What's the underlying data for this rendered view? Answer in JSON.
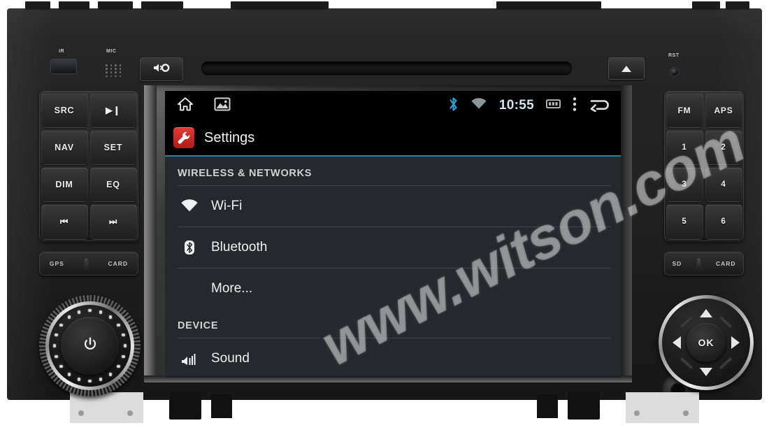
{
  "product": {
    "type": "car-head-unit",
    "watermark": "www.witson.com"
  },
  "front_panel": {
    "ir_label": "IR",
    "mic_label": "MIC",
    "rst_label": "RST",
    "mute_button": {
      "name": "mute-button",
      "icon": "speaker-mute-icon"
    },
    "disc_slot": {
      "name": "cd-disc-slot"
    },
    "eject_button": {
      "name": "eject-button",
      "icon": "eject-triangle-icon"
    },
    "left_keys": [
      "SRC",
      "▶❙",
      "NAV",
      "SET",
      "DIM",
      "EQ",
      "⏮",
      "⏭"
    ],
    "left_slots": [
      "GPS",
      "CARD"
    ],
    "right_keys": [
      "FM",
      "APS",
      "1",
      "2",
      "3",
      "4",
      "5",
      "6"
    ],
    "right_slots": [
      "SD",
      "CARD"
    ],
    "volume_knob": {
      "name": "volume-power-knob",
      "icon": "power-icon"
    },
    "dpad": {
      "ok_label": "OK",
      "up": "up-arrow-icon",
      "down": "down-arrow-icon",
      "left": "left-arrow-icon",
      "right": "right-arrow-icon"
    }
  },
  "screen": {
    "statusbar": {
      "left_icons": [
        {
          "name": "home-icon",
          "label": "Home"
        },
        {
          "name": "gallery-icon",
          "label": "Gallery"
        }
      ],
      "right_icons": [
        {
          "name": "bluetooth-icon",
          "label": "Bluetooth",
          "color": "#2e9fd6"
        },
        {
          "name": "wifi-icon",
          "label": "Wi-Fi",
          "color": "#9aa6ab"
        },
        {
          "name": "screenshot-icon",
          "label": "Screenshot"
        },
        {
          "name": "overflow-menu-icon",
          "label": "More options"
        },
        {
          "name": "back-icon",
          "label": "Back"
        }
      ],
      "time": "10:55",
      "time_color": "#cfe4ef"
    },
    "actionbar": {
      "app_icon": "settings-wrench-icon",
      "title": "Settings",
      "accent_color": "#2a7f9e",
      "icon_color": "#c9302c"
    },
    "sections": [
      {
        "header": "WIRELESS & NETWORKS",
        "items": [
          {
            "label": "Wi-Fi",
            "icon": "wifi-icon"
          },
          {
            "label": "Bluetooth",
            "icon": "bluetooth-icon"
          },
          {
            "label": "More...",
            "icon": ""
          }
        ]
      },
      {
        "header": "DEVICE",
        "items": [
          {
            "label": "Sound",
            "icon": "sound-volume-icon"
          }
        ]
      }
    ]
  }
}
